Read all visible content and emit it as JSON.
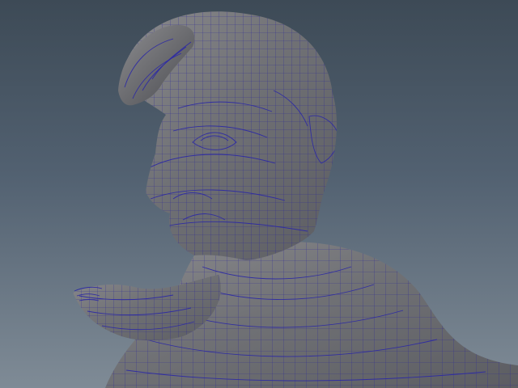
{
  "viewport": {
    "background_top": "#3d4a56",
    "background_bottom": "#7f8b96",
    "mesh_color": "#6d6e72",
    "wire_color": "#2d2aa3"
  },
  "model": {
    "icon": "wireframe-character-head-icon"
  }
}
